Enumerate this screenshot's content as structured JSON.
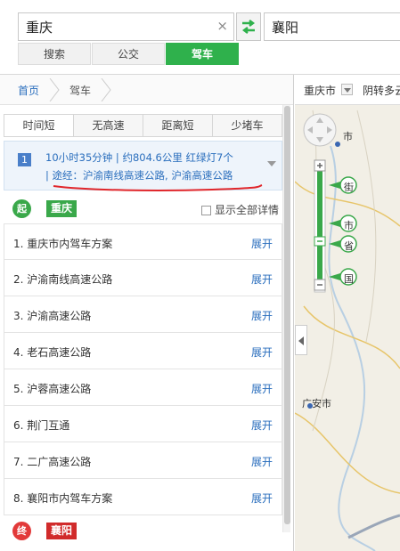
{
  "search": {
    "from_value": "重庆",
    "to_value": "襄阳",
    "clear_icon": "×",
    "swap_icon": "swap-arrows-icon"
  },
  "modes": [
    {
      "label": "搜索",
      "active": false
    },
    {
      "label": "公交",
      "active": false
    },
    {
      "label": "驾车",
      "active": true
    }
  ],
  "breadcrumb": {
    "home": "首页",
    "current": "驾车"
  },
  "plan_tabs": [
    {
      "label": "时间短",
      "active": true
    },
    {
      "label": "无高速",
      "active": false
    },
    {
      "label": "距离短",
      "active": false
    },
    {
      "label": "少堵车",
      "active": false
    }
  ],
  "plan": {
    "number": "1",
    "summary": "10小时35分钟 | 约804.6公里 红绿灯7个",
    "via": "| 途经：沪渝南线高速公路, 沪渝高速公路"
  },
  "start": {
    "badge": "起",
    "name": "重庆",
    "show_all_details": "显示全部详情"
  },
  "steps": [
    {
      "text": "1. 重庆市内驾车方案",
      "action": "展开"
    },
    {
      "text": "2. 沪渝南线高速公路",
      "action": "展开"
    },
    {
      "text": "3. 沪渝高速公路",
      "action": "展开"
    },
    {
      "text": "4. 老石高速公路",
      "action": "展开"
    },
    {
      "text": "5. 沪蓉高速公路",
      "action": "展开"
    },
    {
      "text": "6. 荆门互通",
      "action": "展开"
    },
    {
      "text": "7. 二广高速公路",
      "action": "展开"
    },
    {
      "text": "8. 襄阳市内驾车方案",
      "action": "展开"
    }
  ],
  "end": {
    "badge": "终",
    "name": "襄阳"
  },
  "map": {
    "city": "重庆市",
    "goto": "阴转多云",
    "zoom_levels": [
      "街",
      "市",
      "省",
      "国"
    ],
    "labels": {
      "city1": "市",
      "city2": "广安市"
    }
  },
  "colors": {
    "accent_green": "#2fb14c",
    "link_blue": "#2a6ebd",
    "end_red": "#d12b2b"
  }
}
